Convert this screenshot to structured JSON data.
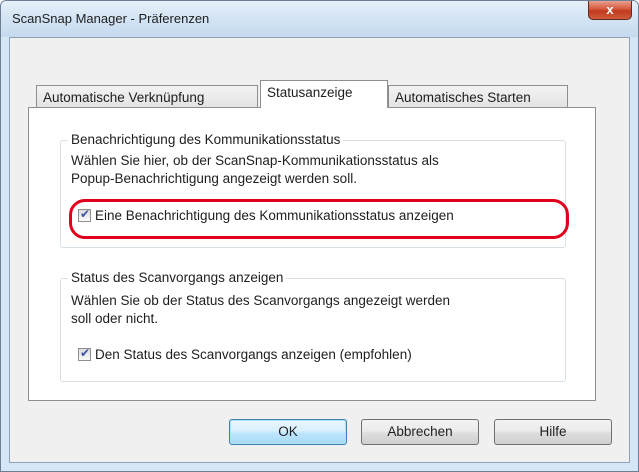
{
  "window": {
    "title": "ScanSnap Manager - Präferenzen",
    "close_glyph": "x"
  },
  "tabs": [
    {
      "label": "Automatische Verknüpfung",
      "active": false
    },
    {
      "label": "Statusanzeige",
      "active": true
    },
    {
      "label": "Automatisches Starten",
      "active": false
    }
  ],
  "group_notification": {
    "legend": "Benachrichtigung des Kommunikationsstatus",
    "description_line1": "Wählen Sie hier, ob der ScanSnap-Kommunikationsstatus als",
    "description_line2": "Popup-Benachrichtigung angezeigt werden soll.",
    "checkbox_label": "Eine Benachrichtigung des Kommunikationsstatus anzeigen",
    "checked": true,
    "highlight_color": "#e0001b"
  },
  "group_scan_status": {
    "legend": "Status des Scanvorgangs anzeigen",
    "description_line1": "Wählen Sie ob der Status des Scanvorgangs angezeigt werden",
    "description_line2": "soll oder nicht.",
    "checkbox_label": "Den Status des Scanvorgangs anzeigen (empfohlen)",
    "checked": true
  },
  "buttons": {
    "ok": "OK",
    "cancel": "Abbrechen",
    "help": "Hilfe"
  },
  "icons": {
    "check_glyph": "✔"
  }
}
